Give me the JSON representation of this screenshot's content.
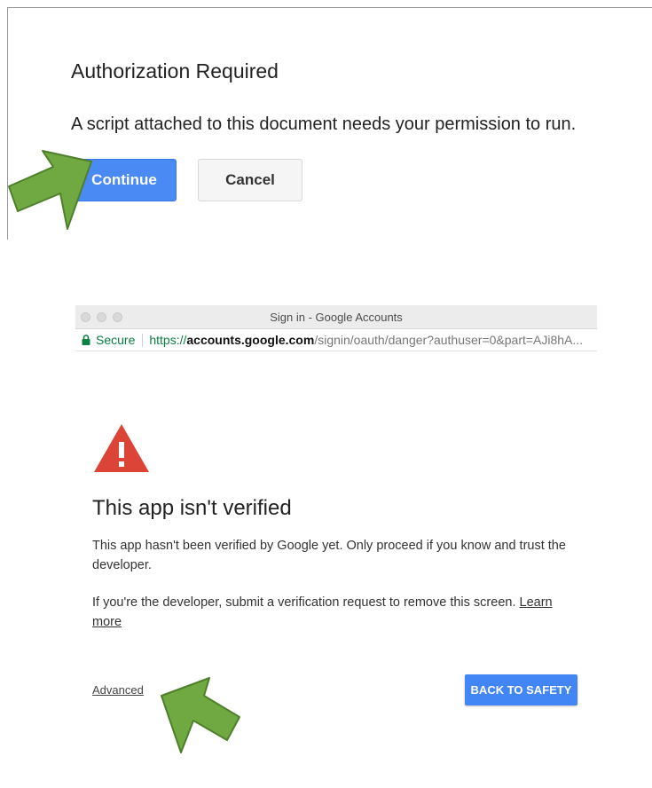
{
  "auth_dialog": {
    "title": "Authorization Required",
    "message": "A script attached to this document needs your permission to run.",
    "continue_label": "Continue",
    "cancel_label": "Cancel"
  },
  "browser": {
    "window_title": "Sign in - Google Accounts",
    "address": {
      "secure_label": "Secure",
      "url_scheme": "https://",
      "url_host": "accounts.google.com",
      "url_path": "/signin/oauth/danger?authuser=0&part=AJi8hA..."
    }
  },
  "warning_page": {
    "title": "This app isn't verified",
    "paragraph1": "This app hasn't been verified by Google yet. Only proceed if you know and trust the developer.",
    "paragraph2": "If you're the developer, submit a verification request to remove this screen. ",
    "learn_more_label": "Learn more",
    "advanced_label": "Advanced",
    "back_to_safety_label": "BACK TO SAFETY"
  },
  "colors": {
    "arrow_green": "#70a942",
    "warning_red": "#db4437",
    "primary_blue": "#4285f4",
    "secure_green": "#0b8043"
  },
  "icons": {
    "arrow": "green-arrow-icon",
    "warning": "warning-triangle-icon",
    "lock": "lock-icon"
  }
}
